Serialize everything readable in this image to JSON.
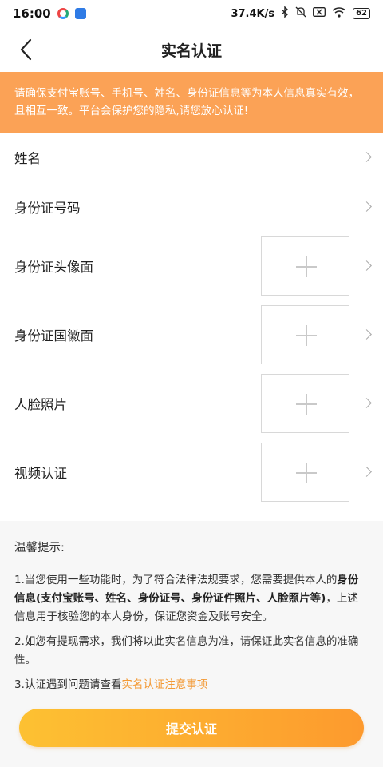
{
  "status_bar": {
    "time": "16:00",
    "network_speed": "37.4K/s",
    "battery": "62"
  },
  "header": {
    "title": "实名认证"
  },
  "notice": {
    "text": "请确保支付宝账号、手机号、姓名、身份证信息等为本人信息真实有效，且相互一致。平台会保护您的隐私,请您放心认证!",
    "background_color": "#fba256"
  },
  "form": {
    "name_label": "姓名",
    "id_number_label": "身份证号码",
    "id_front_label": "身份证头像面",
    "id_back_label": "身份证国徽面",
    "face_photo_label": "人脸照片",
    "video_auth_label": "视频认证"
  },
  "tips": {
    "title": "温馨提示:",
    "tip1_prefix": "1.当您使用一些功能时，为了符合法律法规要求，您需要提供本人的",
    "tip1_bold": "身份信息(支付宝账号、姓名、身份证号、身份证件照片、人脸照片等)",
    "tip1_suffix": "，上述信息用于核验您的本人身份，保证您资金及账号安全。",
    "tip2": "2.如您有提现需求，我们将以此实名信息为准，请保证此实名信息的准确性。",
    "tip3_prefix": "3.认证遇到问题请查看",
    "tip3_link": "实名认证注意事项",
    "accent_color": "#f39a36"
  },
  "submit": {
    "label": "提交认证"
  }
}
